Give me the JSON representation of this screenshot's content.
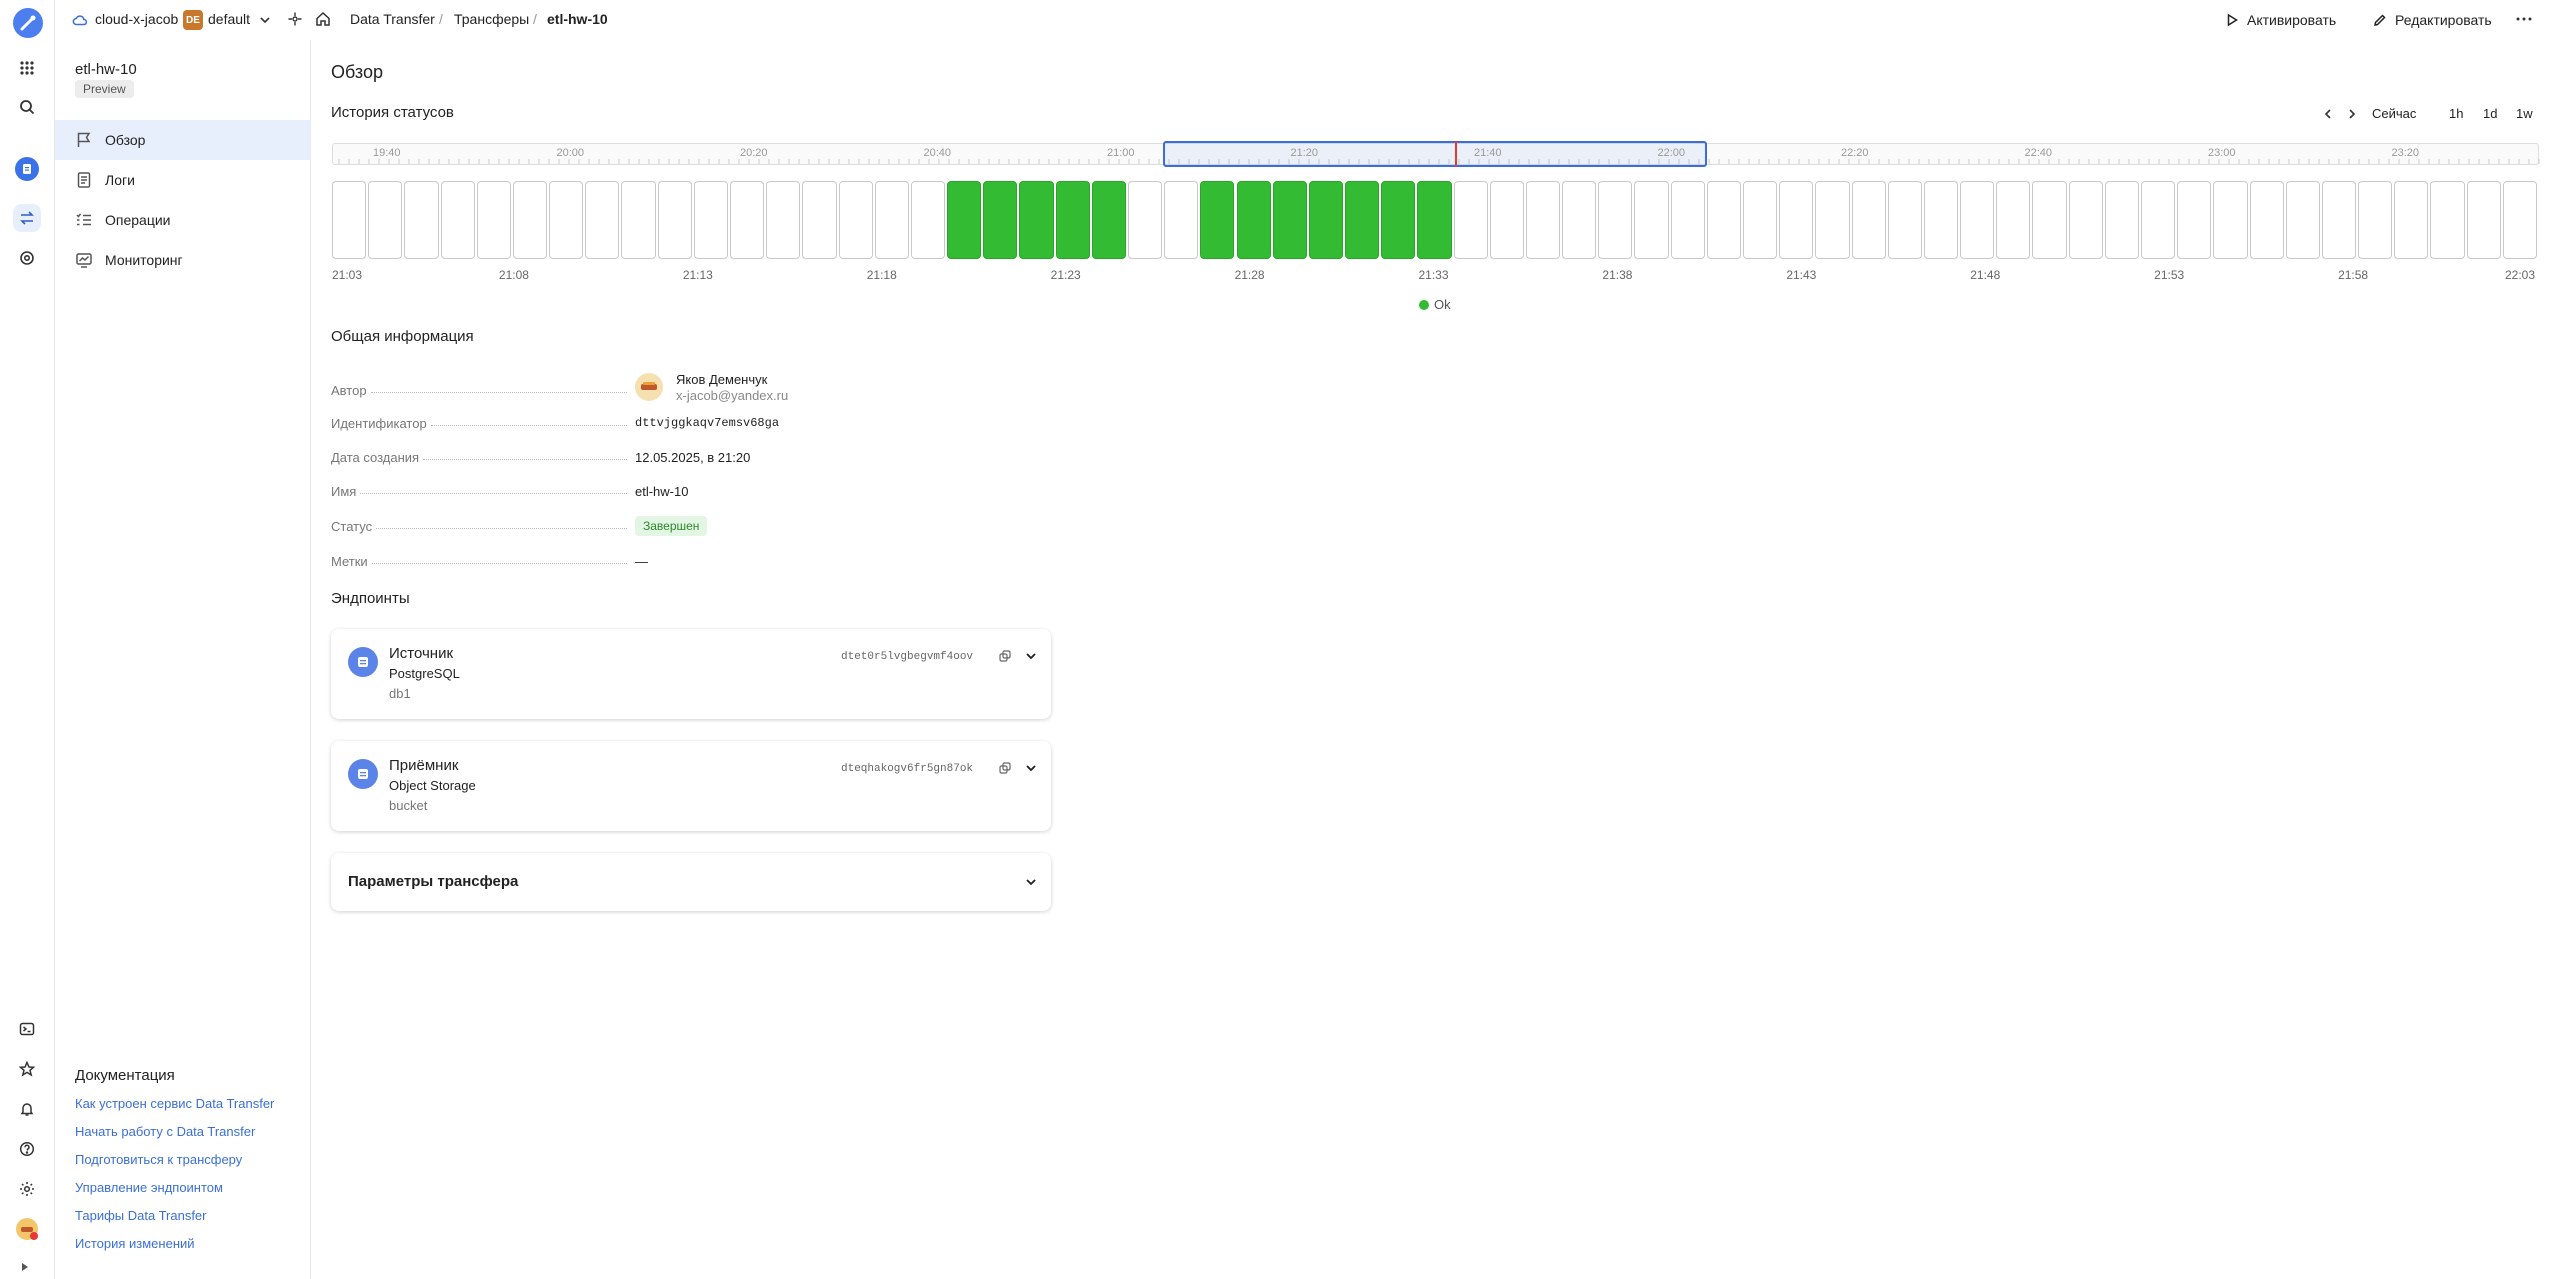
{
  "topbar": {
    "cloud": "cloud-x-jacob",
    "folder_badge": "DE",
    "folder": "default",
    "breadcrumbs": [
      "Data Transfer",
      "Трансферы",
      "etl-hw-10"
    ],
    "activate": "Активировать",
    "edit": "Редактировать"
  },
  "sidebar": {
    "title": "etl-hw-10",
    "badge": "Preview",
    "items": [
      {
        "label": "Обзор",
        "icon": "flag-icon"
      },
      {
        "label": "Логи",
        "icon": "document-icon"
      },
      {
        "label": "Операции",
        "icon": "list-icon"
      },
      {
        "label": "Мониторинг",
        "icon": "monitor-icon"
      }
    ],
    "docs_title": "Документация",
    "docs": [
      "Как устроен сервис Data Transfer",
      "Начать работу с Data Transfer",
      "Подготовиться к трансферу",
      "Управление эндпоинтом",
      "Тарифы Data Transfer",
      "История изменений"
    ]
  },
  "main": {
    "title": "Обзор",
    "history_title": "История статусов",
    "controls": {
      "now": "Сейчас",
      "h": "1h",
      "d": "1d",
      "w": "1w"
    },
    "overview_ticks": [
      "19:40",
      "20:00",
      "20:20",
      "20:40",
      "21:00",
      "21:20",
      "21:40",
      "22:00",
      "22:20",
      "22:40",
      "23:00",
      "23:20"
    ],
    "time_ticks": [
      "21:03",
      "21:08",
      "21:13",
      "21:18",
      "21:23",
      "21:28",
      "21:33",
      "21:38",
      "21:43",
      "21:48",
      "21:53",
      "21:58",
      "22:03"
    ],
    "legend": "Ok",
    "colors": {
      "ok": "#33bb33",
      "accent": "#3b6fd6",
      "marker": "#e53935"
    },
    "ok_slots": [
      17,
      18,
      19,
      20,
      21,
      24,
      25,
      26,
      27,
      28,
      29,
      30
    ],
    "general_title": "Общая информация",
    "info": {
      "author_label": "Автор",
      "author_name": "Яков Деменчук",
      "author_email": "x-jacob@yandex.ru",
      "id_label": "Идентификатор",
      "id_value": "dttvjggkaqv7emsv68ga",
      "created_label": "Дата создания",
      "created_value": "12.05.2025, в 21:20",
      "name_label": "Имя",
      "name_value": "etl-hw-10",
      "status_label": "Статус",
      "status_value": "Завершен",
      "tags_label": "Метки",
      "tags_value": "—"
    },
    "endpoints_title": "Эндпоинты",
    "source": {
      "title": "Источник",
      "type": "PostgreSQL",
      "db": "db1",
      "id": "dtet0r5lvgbegvmf4oov"
    },
    "target": {
      "title": "Приёмник",
      "type": "Object Storage",
      "db": "bucket",
      "id": "dteqhakogv6fr5gn87ok"
    },
    "params_title": "Параметры трансфера"
  }
}
